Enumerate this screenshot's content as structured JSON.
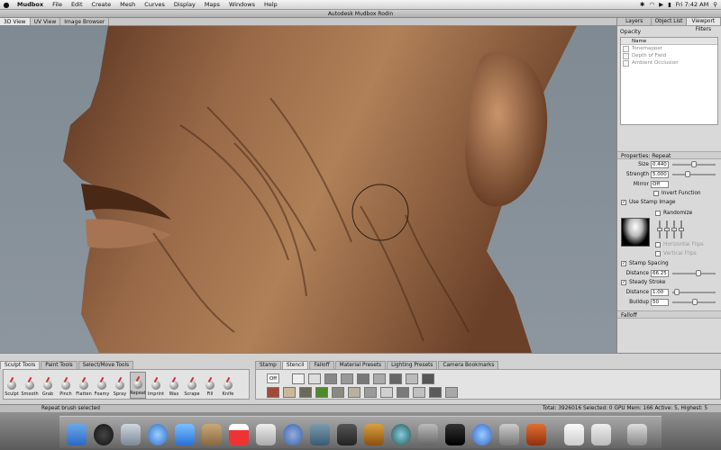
{
  "menubar": {
    "apple_icon": "apple-icon",
    "items": [
      "Mudbox",
      "File",
      "Edit",
      "Create",
      "Mesh",
      "Curves",
      "Display",
      "Maps",
      "Windows",
      "Help"
    ],
    "clock": "Fri 7:42 AM"
  },
  "window": {
    "title": "Autodesk Mudbox Rodin"
  },
  "view_tabs": [
    "3D View",
    "UV View",
    "Image Browser"
  ],
  "right_panel": {
    "tabs": [
      "Layers",
      "Object List",
      "Viewport Filters"
    ],
    "opacity_label": "Opacity",
    "filter_header": "Name",
    "filters": [
      "Tonemapper",
      "Depth of Field",
      "Ambient Occlusion"
    ],
    "properties_title": "Properties: Repeat",
    "size_label": "Size",
    "size_value": "0.440",
    "size_level": 0.44,
    "strength_label": "Strength",
    "strength_value": "5.000",
    "mirror_label": "Mirror",
    "mirror_value": "Off",
    "invert_function": "Invert Function",
    "use_stamp_image": "Use Stamp Image",
    "randomize": "Randomize",
    "horizontal_flips": "Horizontal Flips",
    "vertical_flips": "Vertical Flips",
    "stamp_spacing": "Stamp Spacing",
    "distance_label": "Distance",
    "distance_value": "66.25",
    "steady_stroke": "Steady Stroke",
    "distance2_label": "Distance",
    "distance2_value": "1.00",
    "buildup_label": "Buildup",
    "buildup_value": "50",
    "falloff_label": "Falloff"
  },
  "tool_tabs": [
    "Sculpt Tools",
    "Paint Tools",
    "Select/Move Tools"
  ],
  "tools": [
    "Sculpt",
    "Smooth",
    "Grab",
    "Pinch",
    "Flatten",
    "Foamy",
    "Spray",
    "Repeat",
    "Imprint",
    "Wax",
    "Scrape",
    "Fill",
    "Knife"
  ],
  "active_tool": "Repeat",
  "tray_tabs": [
    "Stamp",
    "Stencil",
    "Falloff",
    "Material Presets",
    "Lighting Presets",
    "Camera Bookmarks"
  ],
  "stencil_off_label": "Off",
  "status": {
    "left": "Repeat brush selected",
    "right": "Total: 3926016  Selected: 0 GPU Mem: 166  Active: 5, Highest: 5"
  },
  "colors": {
    "sculpt": "#8a5a3c",
    "accent": "#3874d8"
  },
  "dock_icons": [
    "finder-icon",
    "dashboard-icon",
    "mail-icon",
    "safari-icon",
    "ichat-icon",
    "address-book-icon",
    "ical-icon",
    "preview-icon",
    "itunes-icon",
    "iphoto-icon",
    "mudbox-icon",
    "garageband-icon",
    "time-machine-icon",
    "system-preferences-icon",
    "terminal-icon",
    "sync-icon",
    "app-icon",
    "mudbox-app-icon",
    "documents-icon",
    "downloads-icon",
    "trash-icon"
  ]
}
